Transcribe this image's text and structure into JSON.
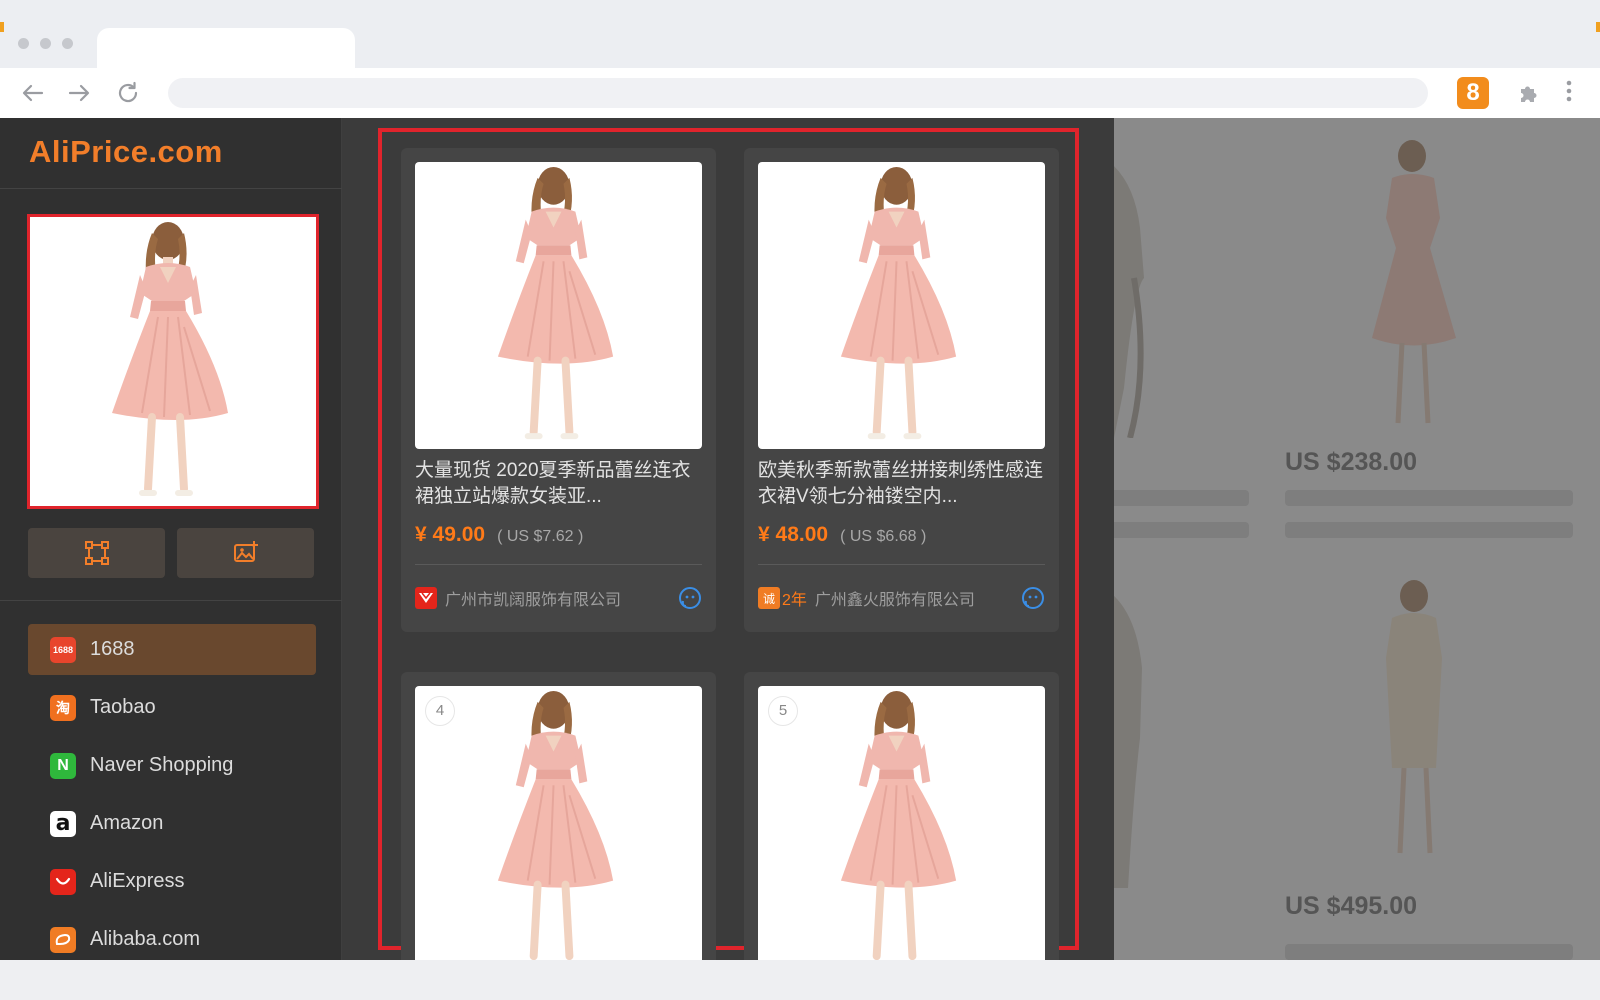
{
  "browser": {
    "extension_badge": "8"
  },
  "sidebar": {
    "logo": "AliPrice.com",
    "sites": [
      {
        "label": "1688",
        "icon": "1688-icon",
        "icon_text": "1688",
        "color": "#e8452c"
      },
      {
        "label": "Taobao",
        "icon": "taobao-icon",
        "icon_text": "淘",
        "color": "#f0701f"
      },
      {
        "label": "Naver Shopping",
        "icon": "naver-icon",
        "icon_text": "N",
        "color": "#2fb83c"
      },
      {
        "label": "Amazon",
        "icon": "amazon-icon",
        "icon_text": "a",
        "color": "#ffffff"
      },
      {
        "label": "AliExpress",
        "icon": "aliexpress-icon",
        "icon_text": "",
        "color": "#e4251b"
      },
      {
        "label": "Alibaba.com",
        "icon": "alibaba-icon",
        "icon_text": "",
        "color": "#f07c24"
      }
    ]
  },
  "results": [
    {
      "title": "大量现货 2020夏季新品蕾丝连衣裙独立站爆款女装亚...",
      "price": "¥ 49.00",
      "price_usd": "( US $7.62 )",
      "shop": "广州市凯阔服饰有限公司",
      "years": ""
    },
    {
      "title": "欧美秋季新款蕾丝拼接刺绣性感连衣裙V领七分袖镂空内...",
      "price": "¥ 48.00",
      "price_usd": "( US $6.68 )",
      "shop": "广州鑫火服饰有限公司",
      "years": "2年"
    },
    {
      "rank": "4"
    },
    {
      "rank": "5"
    }
  ],
  "background_page": {
    "prices": [
      "US $238.00",
      "US $495.00"
    ]
  },
  "colors": {
    "accent": "#f27e2a",
    "highlight_border": "#e0242c",
    "price": "#ff7a18"
  }
}
